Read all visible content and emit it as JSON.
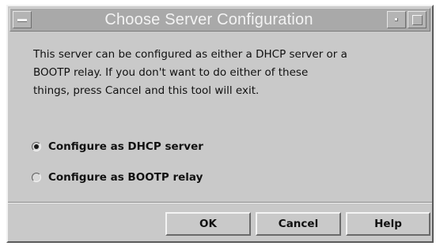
{
  "window": {
    "title": "Choose Server Configuration"
  },
  "message": {
    "line1": "This server can be configured as either a DHCP server or a",
    "line2": "BOOTP relay.  If you don't want to do either of these",
    "line3": "things, press Cancel and this tool will exit."
  },
  "options": [
    {
      "label": "Configure as DHCP server",
      "selected": true
    },
    {
      "label": "Configure as BOOTP relay",
      "selected": false
    }
  ],
  "buttons": {
    "ok": "OK",
    "cancel": "Cancel",
    "help": "Help"
  },
  "icons": {
    "window_menu": "window-menu-icon",
    "minimize": "minimize-icon",
    "maximize": "maximize-icon"
  },
  "colors": {
    "dialog_background": "#c9c9c9",
    "titlebar_background": "#a9a9a9",
    "title_text": "#f3f3f3"
  }
}
